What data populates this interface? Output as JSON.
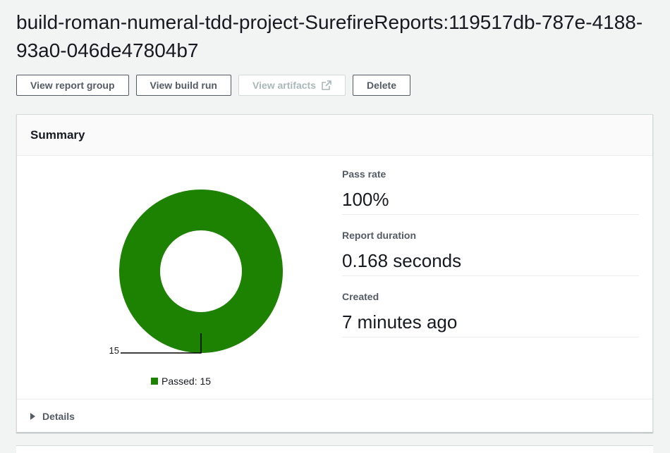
{
  "page": {
    "title": "build-roman-numeral-tdd-project-SurefireReports:119517db-787e-4188-93a0-046de47804b7"
  },
  "actions": {
    "view_report_group": "View report group",
    "view_build_run": "View build run",
    "view_artifacts": "View artifacts",
    "delete": "Delete"
  },
  "summary": {
    "header": "Summary",
    "metrics": [
      {
        "label": "Pass rate",
        "value": "100%"
      },
      {
        "label": "Report duration",
        "value": "0.168 seconds"
      },
      {
        "label": "Created",
        "value": "7 minutes ago"
      }
    ],
    "details_label": "Details"
  },
  "colors": {
    "passed": "#1d8102"
  },
  "chart_data": {
    "type": "pie",
    "donut": true,
    "series": [
      {
        "name": "Passed",
        "value": 15
      }
    ],
    "slice_labels": [
      "15"
    ],
    "legend": [
      "Passed: 15"
    ],
    "legend_placement": "bottom"
  }
}
